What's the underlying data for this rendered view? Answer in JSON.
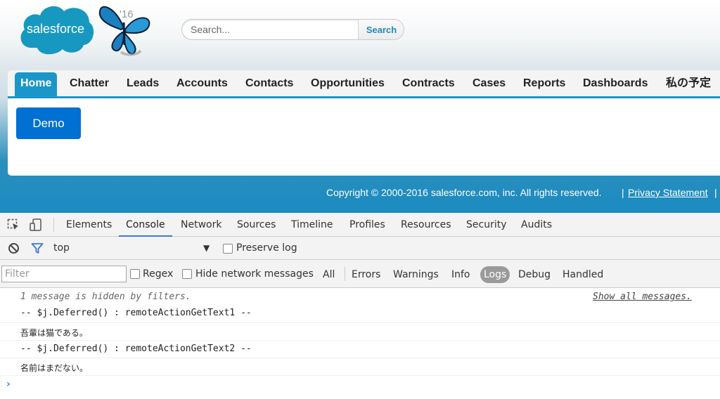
{
  "logo": {
    "text": "salesforce",
    "year": "'16",
    "brand_color": "#1798c1"
  },
  "search": {
    "placeholder": "Search...",
    "button_label": "Search"
  },
  "tabs": [
    {
      "label": "Home",
      "active": true
    },
    {
      "label": "Chatter"
    },
    {
      "label": "Leads"
    },
    {
      "label": "Accounts"
    },
    {
      "label": "Contacts"
    },
    {
      "label": "Opportunities"
    },
    {
      "label": "Contracts"
    },
    {
      "label": "Cases"
    },
    {
      "label": "Reports"
    },
    {
      "label": "Dashboards"
    },
    {
      "label": "私の予定"
    }
  ],
  "content": {
    "demo_button": "Demo"
  },
  "footer": {
    "copyright": "Copyright © 2000-2016 salesforce.com, inc. All rights reserved.",
    "separator": "|",
    "privacy": "Privacy Statement"
  },
  "devtools": {
    "tabs": [
      {
        "label": "Elements"
      },
      {
        "label": "Console",
        "active": true
      },
      {
        "label": "Network"
      },
      {
        "label": "Sources"
      },
      {
        "label": "Timeline"
      },
      {
        "label": "Profiles"
      },
      {
        "label": "Resources"
      },
      {
        "label": "Security"
      },
      {
        "label": "Audits"
      }
    ],
    "console_bar": {
      "context": "top",
      "preserve_log": "Preserve log"
    },
    "filter_bar": {
      "filter_placeholder": "Filter",
      "regex": "Regex",
      "hide_network": "Hide network messages",
      "levels": [
        {
          "label": "All"
        },
        {
          "label": "Errors"
        },
        {
          "label": "Warnings"
        },
        {
          "label": "Info"
        },
        {
          "label": "Logs",
          "active": true
        },
        {
          "label": "Debug"
        },
        {
          "label": "Handled"
        }
      ]
    },
    "messages": {
      "hidden_notice": "1 message is hidden by filters.",
      "show_all": "Show all messages.",
      "lines": [
        "-- $j.Deferred() : remoteActionGetText1 --",
        "吾輩は猫である。",
        "-- $j.Deferred() : remoteActionGetText2 --",
        "名前はまだない。"
      ]
    },
    "accent_color": "#3879d9"
  }
}
